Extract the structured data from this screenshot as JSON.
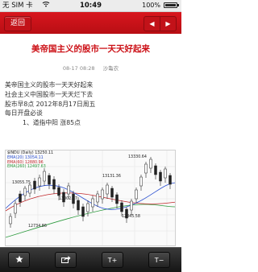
{
  "status_bar": {
    "carrier": "无 SIM 卡",
    "wifi_icon": "wifi-icon",
    "time": "10:49",
    "battery_pct": "100%",
    "battery_level": 1.0
  },
  "nav": {
    "back_label": "返回",
    "prev_icon": "triangle-left-icon",
    "next_icon": "triangle-right-icon",
    "accent": "#cc1016"
  },
  "article": {
    "title": "美帝国主义的股市一天天好起来",
    "date": "08-17 08:28",
    "author": "沙亀农",
    "lines": [
      "美帝国主义的股市一天天好起来",
      "社会主义中国股市一天天烂下去",
      "股市早8点  2012年8月17日周五",
      "每日开盘必谈",
      "1、道指中阳  涨85点"
    ]
  },
  "chart_image": {
    "legend": [
      "$INDU (Daily) 13250.11",
      "EMA(20) 13054.11",
      "EMA(60) 12880.96",
      "EMA(260) 12497.63"
    ],
    "value_labels": [
      "13330.64",
      "13055.75",
      "13131.36",
      "13002.77",
      "12734.86",
      "12845.58"
    ]
  },
  "toolbar": {
    "favorite_icon": "star-icon",
    "share_icon": "share-icon",
    "font_increase_label": "T+",
    "font_decrease_label": "T−"
  }
}
